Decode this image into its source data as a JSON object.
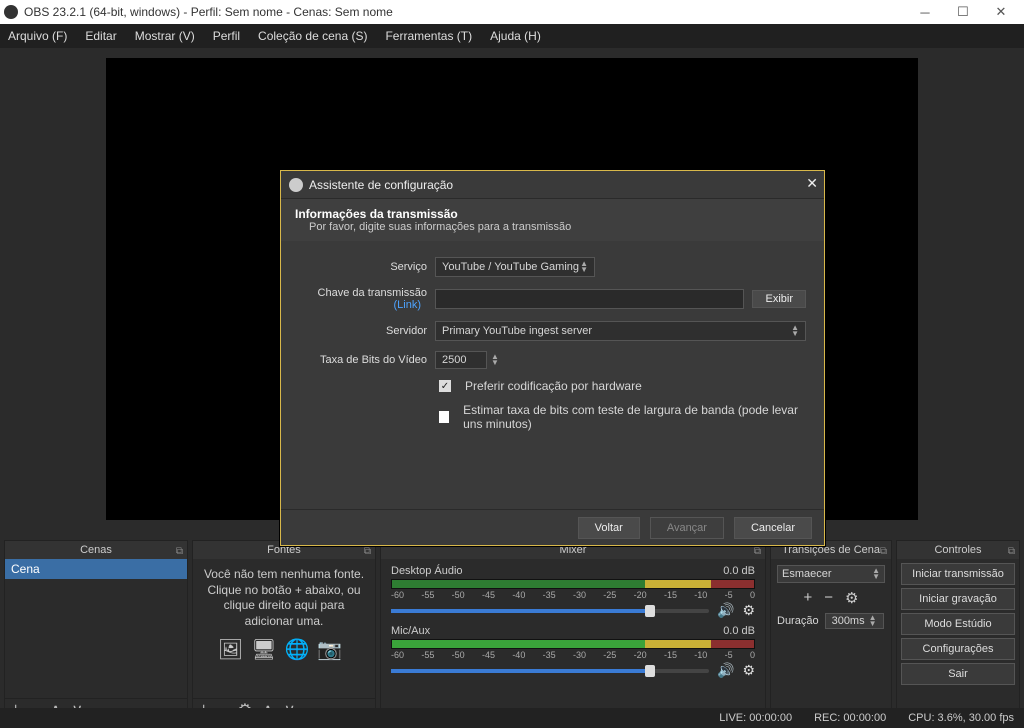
{
  "titlebar": {
    "title": "OBS 23.2.1 (64-bit, windows) - Perfil: Sem nome - Cenas: Sem nome"
  },
  "menu": {
    "arquivo": "Arquivo (F)",
    "editar": "Editar",
    "mostrar": "Mostrar (V)",
    "perfil": "Perfil",
    "colecao": "Coleção de cena (S)",
    "ferramentas": "Ferramentas (T)",
    "ajuda": "Ajuda (H)"
  },
  "docks": {
    "scenes": {
      "title": "Cenas",
      "item": "Cena"
    },
    "sources": {
      "title": "Fontes",
      "hint": "Você não tem nenhuma fonte. Clique no botão + abaixo, ou clique direito aqui para adicionar uma."
    },
    "mixer": {
      "title": "Mixer",
      "desktop": {
        "name": "Desktop Áudio",
        "db": "0.0 dB"
      },
      "mic": {
        "name": "Mic/Aux",
        "db": "0.0 dB"
      },
      "ticks": [
        "-60",
        "-55",
        "-50",
        "-45",
        "-40",
        "-35",
        "-30",
        "-25",
        "-20",
        "-15",
        "-10",
        "-5",
        "0"
      ]
    },
    "trans": {
      "title": "Transições de Cena",
      "sel": "Esmaecer",
      "durLabel": "Duração",
      "durVal": "300ms"
    },
    "controls": {
      "title": "Controles",
      "start": "Iniciar transmissão",
      "rec": "Iniciar gravação",
      "studio": "Modo Estúdio",
      "settings": "Configurações",
      "exit": "Sair"
    }
  },
  "status": {
    "live": "LIVE: 00:00:00",
    "rec": "REC: 00:00:00",
    "cpu": "CPU: 3.6%, 30.00 fps"
  },
  "wizard": {
    "title": "Assistente de configuração",
    "heading": "Informações da transmissão",
    "sub": "Por favor, digite suas informações para a transmissão",
    "serviceLabel": "Serviço",
    "serviceVal": "YouTube / YouTube Gaming",
    "keyLabel": "Chave da transmissão",
    "keyLink": "(Link)",
    "showBtn": "Exibir",
    "serverLabel": "Servidor",
    "serverVal": "Primary YouTube ingest server",
    "bitrateLabel": "Taxa de Bits do Vídeo",
    "bitrateVal": "2500",
    "chk1": "Preferir codificação por hardware",
    "chk2": "Estimar taxa de bits com teste de largura de banda (pode levar uns minutos)",
    "back": "Voltar",
    "next": "Avançar",
    "cancel": "Cancelar"
  }
}
